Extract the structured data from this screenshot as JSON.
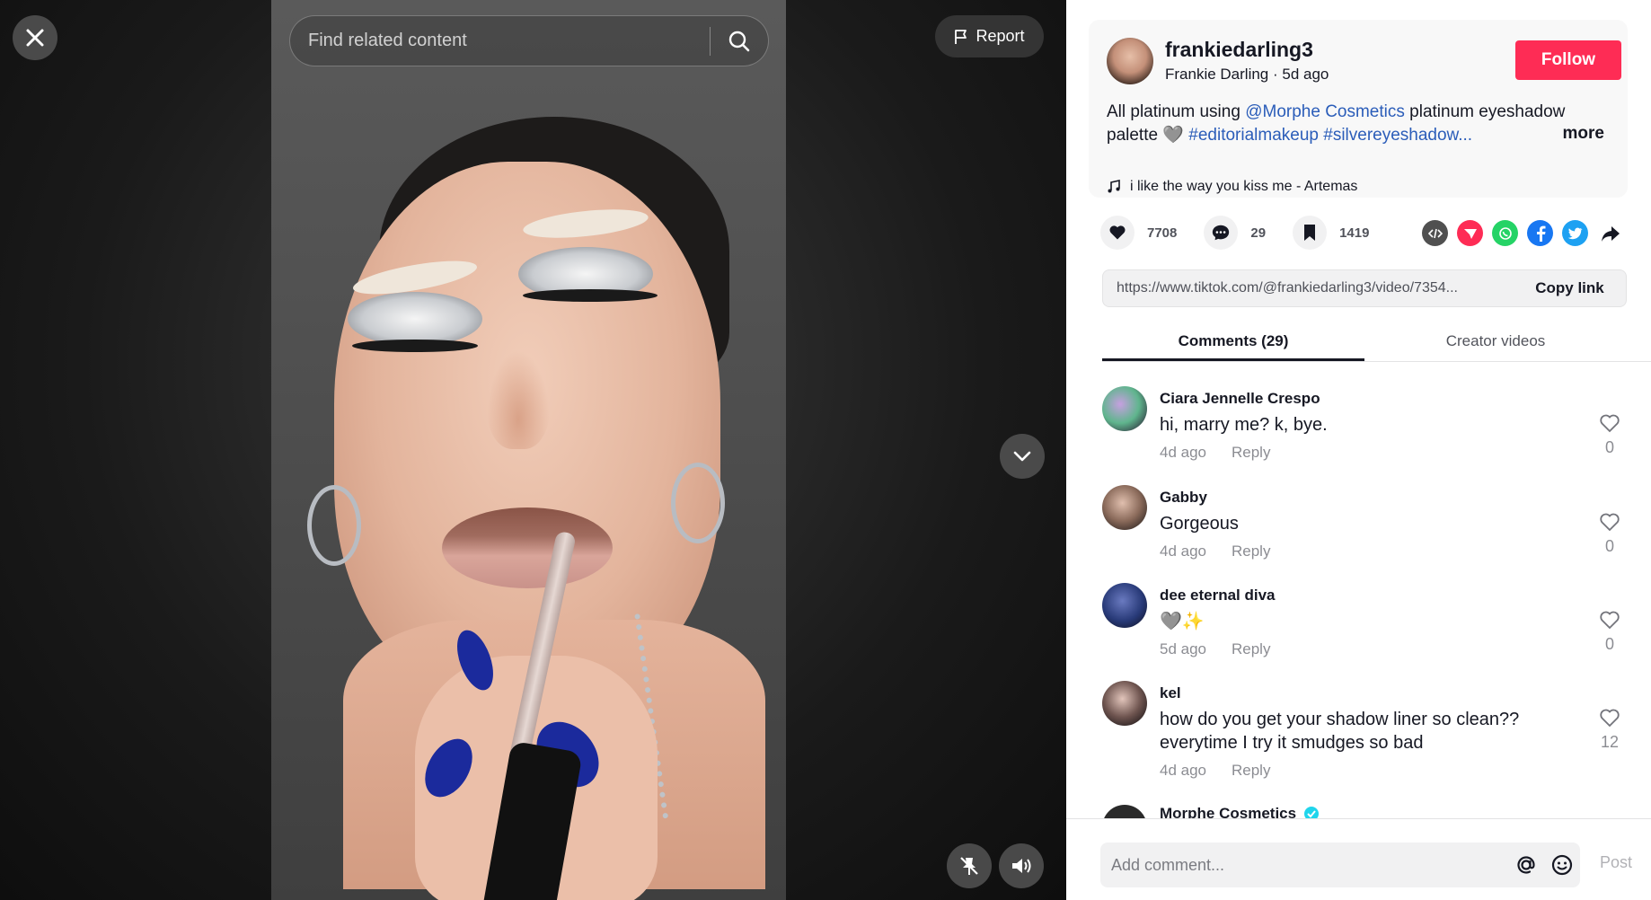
{
  "video": {
    "search_placeholder": "Find related content",
    "report_label": "Report"
  },
  "author": {
    "username": "frankiedarling3",
    "display_name": "Frankie Darling",
    "posted": "5d ago",
    "follow_label": "Follow"
  },
  "caption": {
    "text_1": "All platinum using ",
    "mention": "@Morphe Cosmetics",
    "text_2": " platinum eyeshadow palette 🩶 ",
    "hashtag_1": "#editorialmakeup",
    "hashtag_2": "#silvereyeshadow...",
    "more_label": "more",
    "music": "i like the way you kiss me - Artemas"
  },
  "stats": {
    "likes": "7708",
    "comments": "29",
    "saves": "1419"
  },
  "share_icons": [
    {
      "name": "embed-icon",
      "color": "#505050"
    },
    {
      "name": "send-icon",
      "color": "#fe2c55"
    },
    {
      "name": "whatsapp-icon",
      "color": "#25d366"
    },
    {
      "name": "facebook-icon",
      "color": "#1877f2"
    },
    {
      "name": "twitter-icon",
      "color": "#1da1f2"
    },
    {
      "name": "share-arrow-icon",
      "color": "#161823"
    }
  ],
  "link": {
    "url": "https://www.tiktok.com/@frankiedarling3/video/7354...",
    "copy_label": "Copy link"
  },
  "tabs": {
    "comments": "Comments (29)",
    "creator": "Creator videos"
  },
  "comments": [
    {
      "user": "Ciara Jennelle Crespo",
      "text": "hi, marry me? k, bye.",
      "time": "4d ago",
      "reply": "Reply",
      "likes": "0"
    },
    {
      "user": "Gabby",
      "text": "Gorgeous",
      "time": "4d ago",
      "reply": "Reply",
      "likes": "0"
    },
    {
      "user": "dee eternal diva",
      "text": "🩶✨",
      "time": "5d ago",
      "reply": "Reply",
      "likes": "0"
    },
    {
      "user": "kel",
      "text": "how do you get your shadow liner so clean?? everytime I try it smudges so bad",
      "time": "4d ago",
      "reply": "Reply",
      "likes": "12"
    },
    {
      "user": "Morphe Cosmetics"
    }
  ],
  "comment_bar": {
    "placeholder": "Add comment...",
    "post_label": "Post"
  },
  "colors": {
    "accent": "#fe2c55",
    "link": "#2b5db9"
  }
}
